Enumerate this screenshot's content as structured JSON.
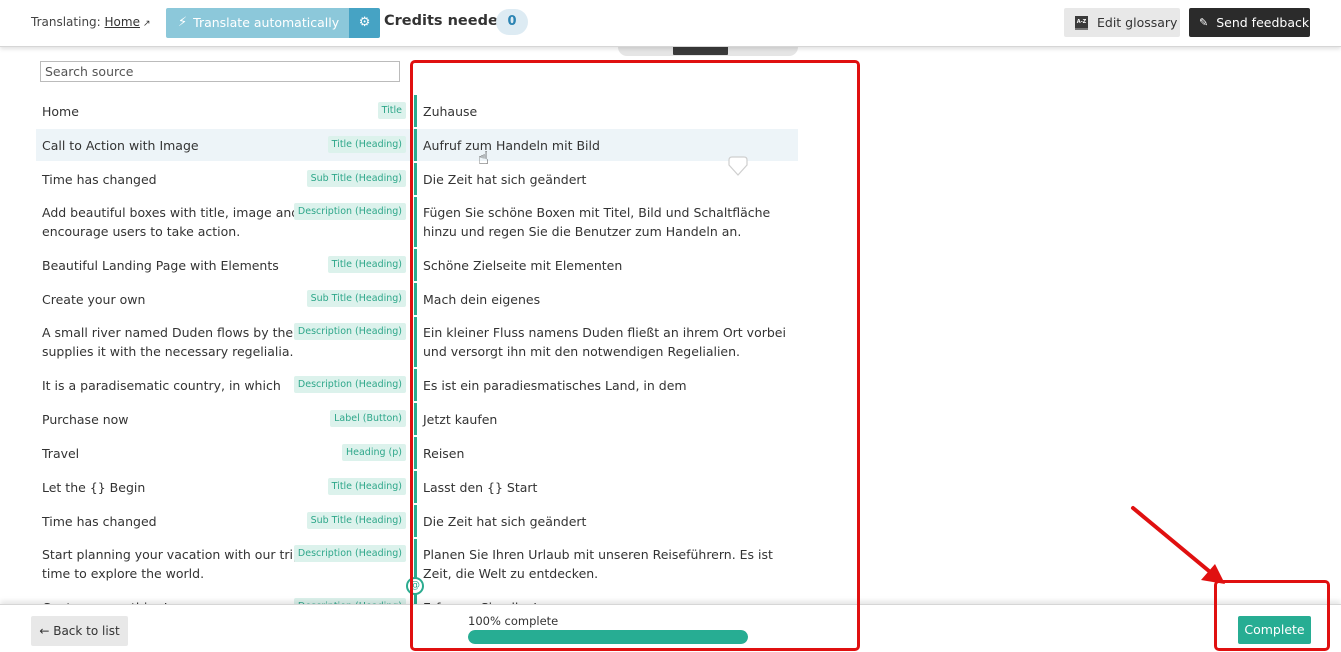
{
  "header": {
    "translating_label": "Translating:",
    "page_link": "Home",
    "translate_auto_label": "Translate automatically",
    "credits_label": "Credits needed",
    "credits_value": "0",
    "edit_glossary_label": "Edit glossary",
    "glossary_icon_text": "A-Z",
    "send_feedback_label": "Send feedback"
  },
  "search": {
    "placeholder": "Search source",
    "value": ""
  },
  "rows": [
    {
      "source": "Home",
      "tag": "Title",
      "target": "Zuhause",
      "selected": false
    },
    {
      "source": "Call to Action with Image",
      "tag": "Title (Heading)",
      "target": "Aufruf zum Handeln mit Bild",
      "selected": true
    },
    {
      "source": "Time has changed",
      "tag": "Sub Title (Heading)",
      "target": "Die Zeit hat sich geändert",
      "selected": false
    },
    {
      "source": "Add beautiful boxes with title, image and button and encourage users to take action.",
      "tag": "Description (Heading)",
      "target": "Fügen Sie schöne Boxen mit Titel, Bild und Schaltfläche hinzu und regen Sie die Benutzer zum Handeln an.",
      "selected": false
    },
    {
      "source": "Beautiful Landing Page with Elements",
      "tag": "Title (Heading)",
      "target": "Schöne Zielseite mit Elementen",
      "selected": false
    },
    {
      "source": "Create your own",
      "tag": "Sub Title (Heading)",
      "target": "Mach dein eigenes",
      "selected": false
    },
    {
      "source": "A small river named Duden flows by their place and supplies it with the necessary regelialia.",
      "tag": "Description (Heading)",
      "target": "Ein kleiner Fluss namens Duden fließt an ihrem Ort vorbei und versorgt ihn mit den notwendigen Regelialien.",
      "selected": false
    },
    {
      "source": "It is a paradisematic country, in which",
      "tag": "Description (Heading)",
      "target": "Es ist ein paradiesmatisches Land, in dem",
      "selected": false
    },
    {
      "source": "Purchase now",
      "tag": "Label (Button)",
      "target": "Jetzt kaufen",
      "selected": false
    },
    {
      "source": "Travel",
      "tag": "Heading (p)",
      "target": "Reisen",
      "selected": false
    },
    {
      "source": "Let the {} Begin",
      "tag": "Title (Heading)",
      "target": "Lasst den {} Start",
      "selected": false
    },
    {
      "source": "Time has changed",
      "tag": "Sub Title (Heading)",
      "target": "Die Zeit hat sich geändert",
      "selected": false
    },
    {
      "source": "Start planning your vacation with our trip guides, It's time to explore the world.",
      "tag": "Description (Heading)",
      "target": "Planen Sie Ihren Urlaub mit unseren Reiseführern. Es ist Zeit, die Welt zu entdecken.",
      "selected": false
    },
    {
      "source": "Capture everything!",
      "tag": "Description (Heading)",
      "target": "Erfassen Sie alles!",
      "selected": false
    }
  ],
  "footer": {
    "back_label": "← Back to list",
    "progress_label": "100% complete",
    "progress_percent": 100,
    "complete_label": "Complete"
  },
  "colors": {
    "accent_green": "#27ad93",
    "auto_translate_blue": "#8cc8da",
    "annotation_red": "#e01010"
  }
}
